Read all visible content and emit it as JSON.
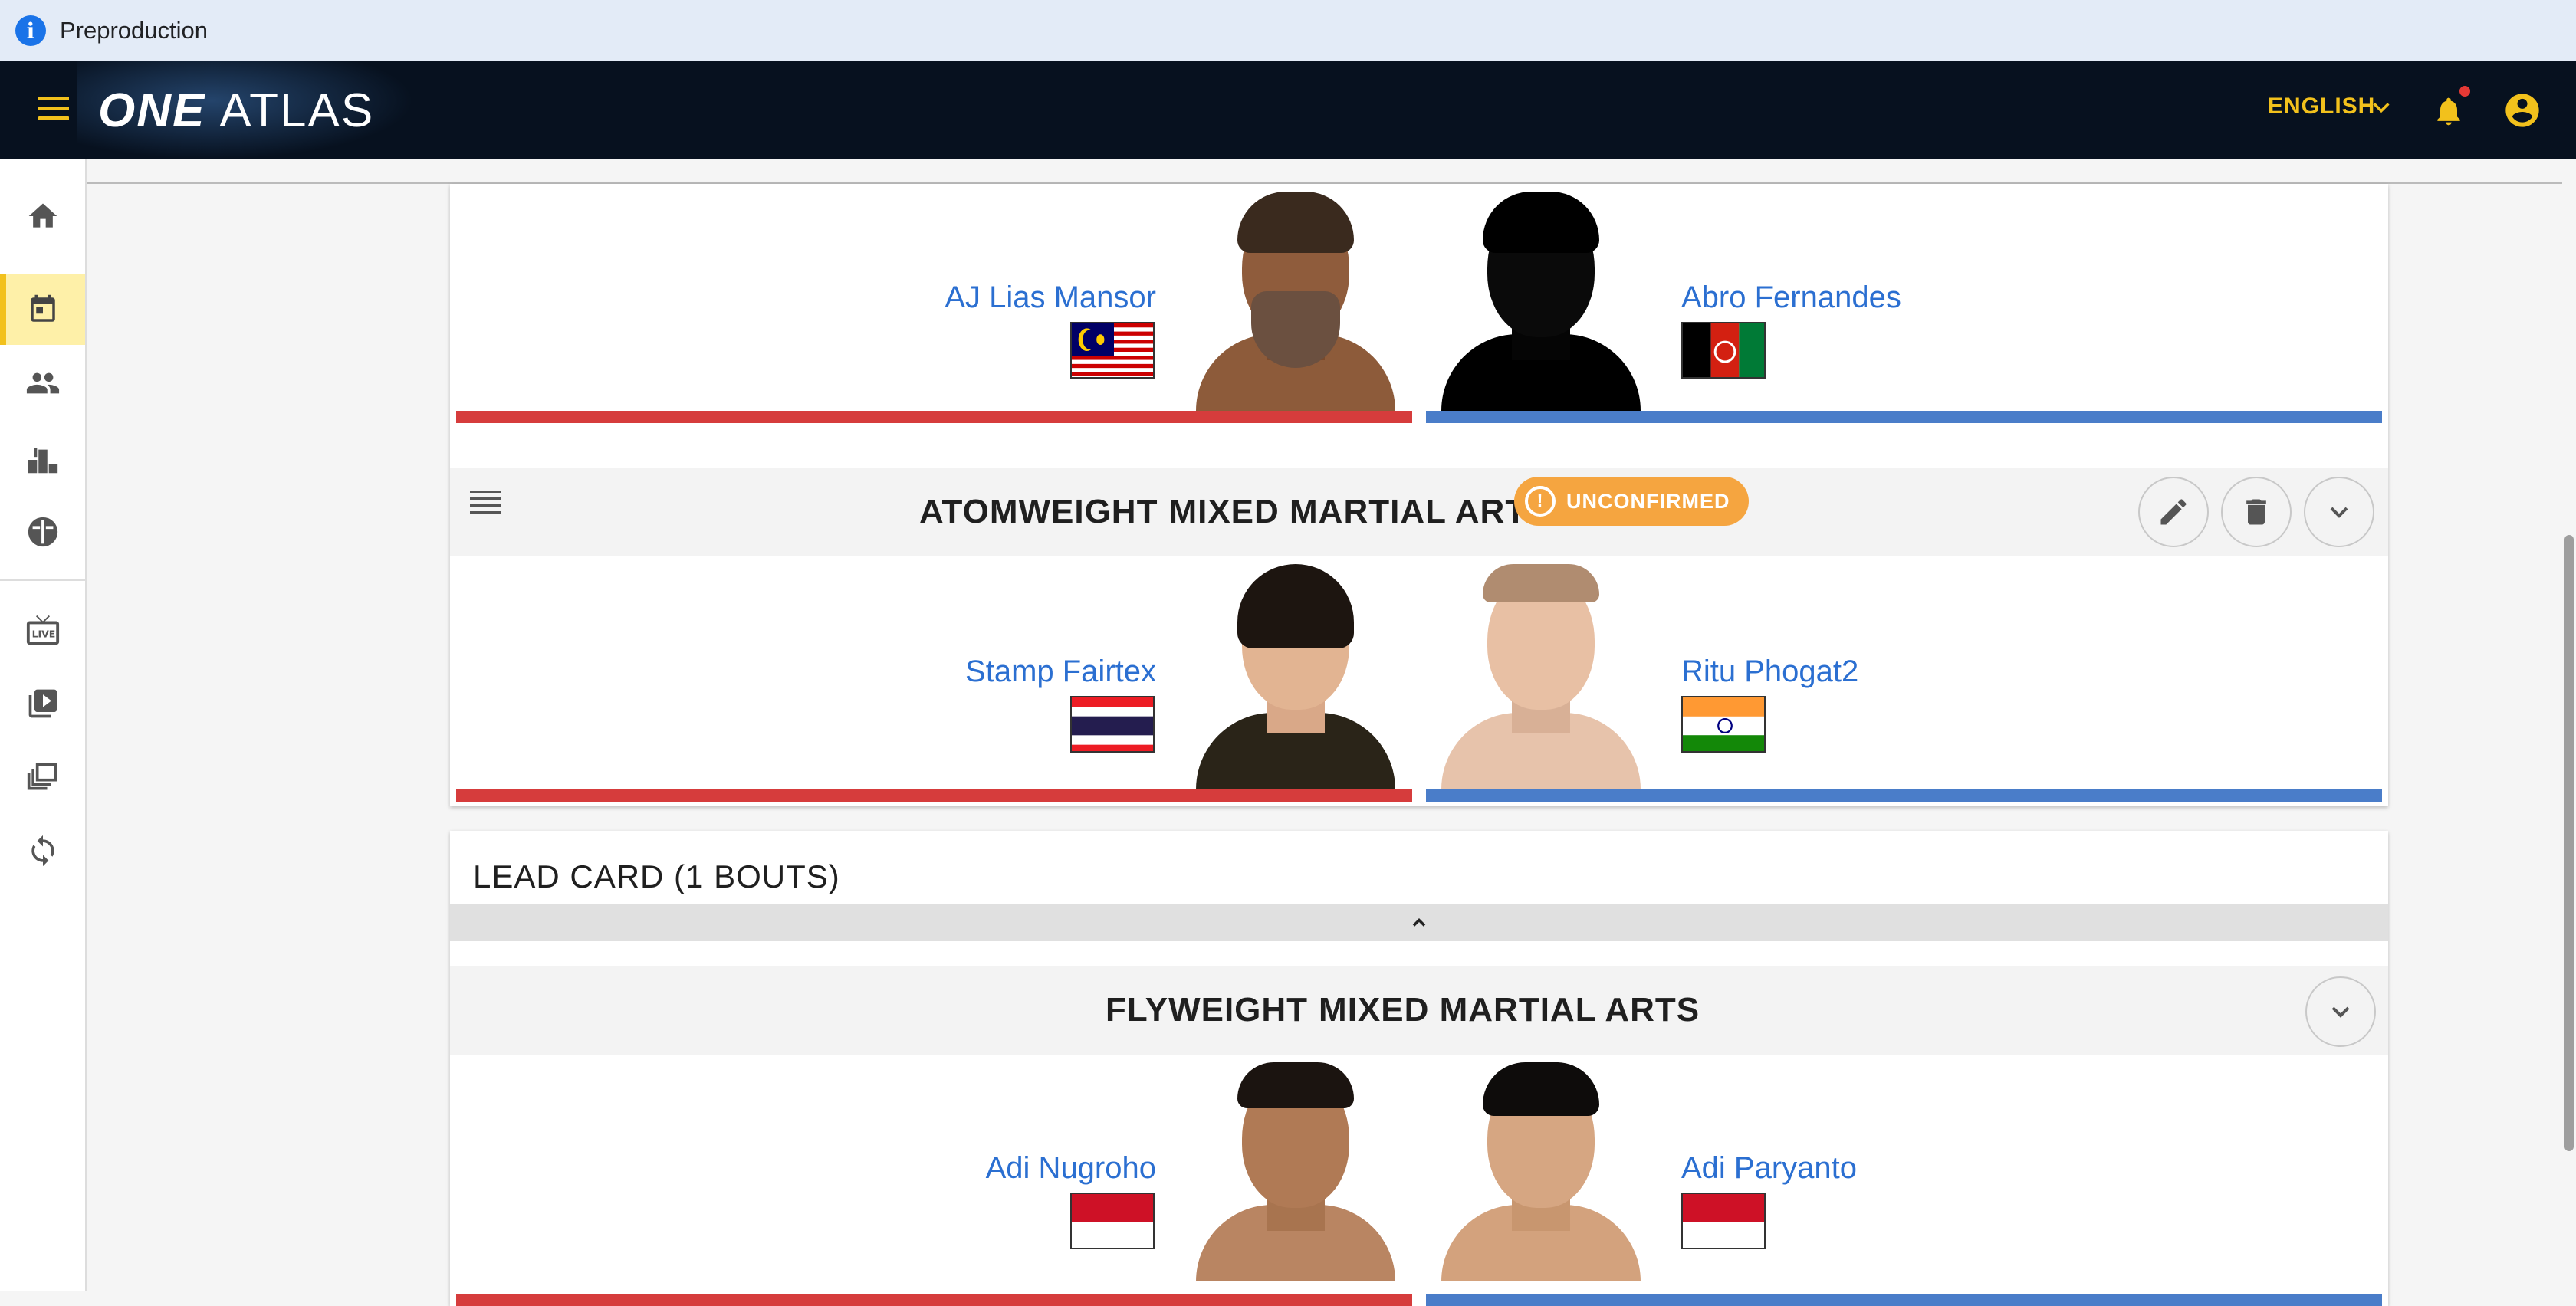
{
  "env_banner": {
    "text": "Preproduction",
    "icon": "info-icon"
  },
  "header": {
    "logo_one": "ONE",
    "logo_atlas": "ATLAS",
    "language": "ENGLISH",
    "icons": [
      "menu-icon",
      "chevron-down-icon",
      "notifications-icon",
      "account-circle-icon"
    ],
    "notification_dot_color": "#e53935",
    "accent_color": "#f2c11c"
  },
  "sidebar": {
    "items": [
      {
        "icon": "home-icon",
        "active": false
      },
      {
        "icon": "calendar-icon",
        "active": true
      },
      {
        "icon": "people-icon",
        "active": false
      },
      {
        "icon": "rankings-icon",
        "active": false
      },
      {
        "icon": "gloves-icon",
        "active": false
      },
      {
        "icon": "live-tv-icon",
        "active": false
      },
      {
        "icon": "video-library-icon",
        "active": false
      },
      {
        "icon": "collections-icon",
        "active": false
      },
      {
        "icon": "sync-icon",
        "active": false
      }
    ]
  },
  "bouts": [
    {
      "red": {
        "name": "AJ Lias Mansor",
        "country_flag": "Malaysia"
      },
      "blue": {
        "name": "Abro Fernandes",
        "country_flag": "Afghanistan"
      }
    },
    {
      "title_weight": "ATOMWEIGHT",
      "title_sport": "MIXED MARTIAL ARTS",
      "status": "UNCONFIRMED",
      "red": {
        "name": "Stamp Fairtex",
        "country_flag": "Thailand"
      },
      "blue": {
        "name": "Ritu Phogat2",
        "country_flag": "India"
      }
    }
  ],
  "lead_card": {
    "title": "LEAD CARD (1 BOUTS)",
    "bout": {
      "title_weight": "FLYWEIGHT",
      "title_sport": "MIXED MARTIAL ARTS",
      "red": {
        "name": "Adi Nugroho",
        "country_flag": "Indonesia"
      },
      "blue": {
        "name": "Adi Paryanto",
        "country_flag": "Indonesia"
      }
    }
  },
  "colors": {
    "red_corner": "#d63c3c",
    "blue_corner": "#4a7dc9",
    "link": "#2b6fd1",
    "badge": "#f5a540"
  }
}
